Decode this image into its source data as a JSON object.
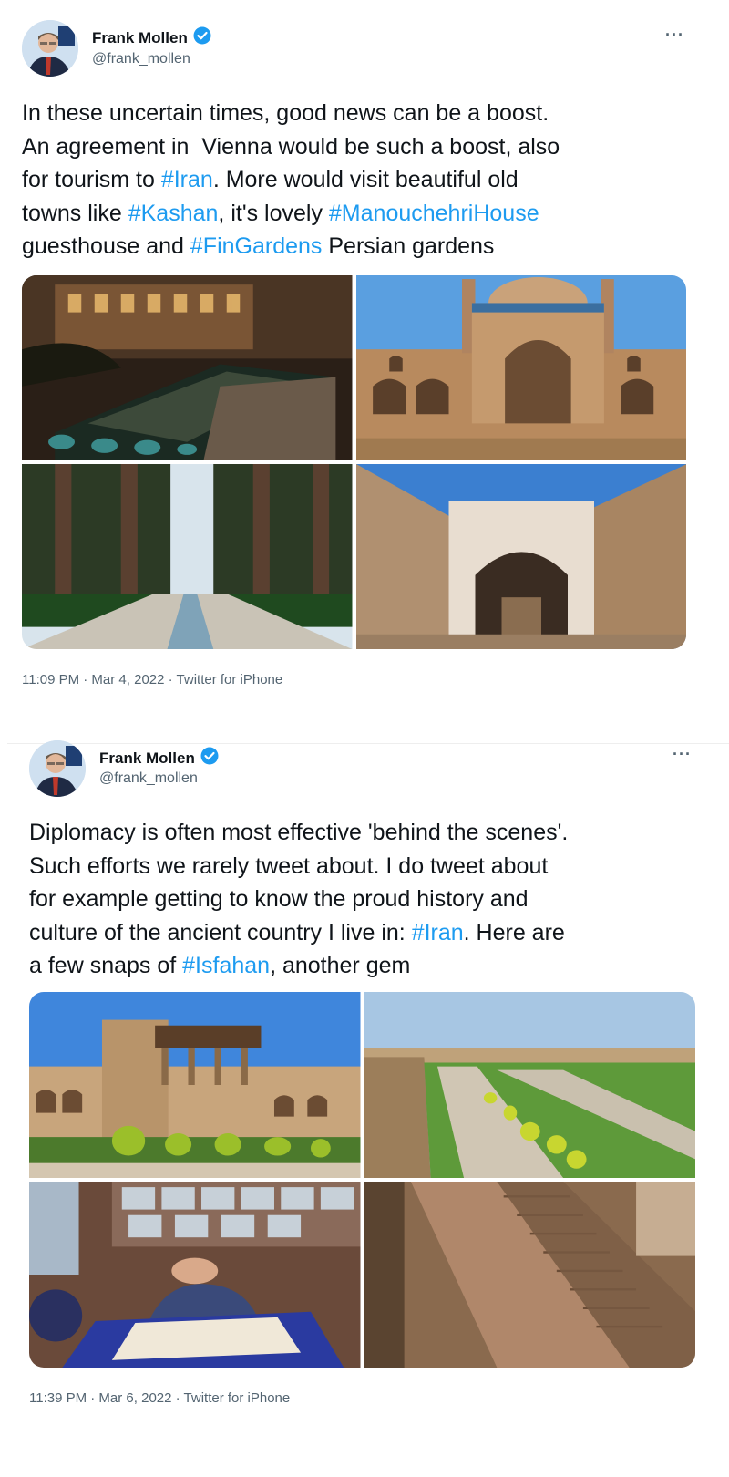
{
  "tweets": [
    {
      "author": {
        "name": "Frank Mollen",
        "handle": "@frank_mollen",
        "verified": true
      },
      "more_label": "···",
      "text_parts": [
        {
          "t": "In these uncertain times, good news can be a boost.\nAn agreement in  Vienna would be such a boost, also\nfor tourism to ",
          "tag": false
        },
        {
          "t": "#Iran",
          "tag": true
        },
        {
          "t": ". More would visit beautiful old\ntowns like ",
          "tag": false
        },
        {
          "t": "#Kashan",
          "tag": true
        },
        {
          "t": ", it's lovely ",
          "tag": false
        },
        {
          "t": "#ManouchehriHouse",
          "tag": true
        },
        {
          "t": "\nguesthouse and ",
          "tag": false
        },
        {
          "t": "#FinGardens",
          "tag": true
        },
        {
          "t": " Persian gardens",
          "tag": false
        }
      ],
      "photos": [
        "courtyard-pool-night-photo",
        "agha-bozorg-mosque-photo",
        "fin-garden-path-photo",
        "arched-alley-photo"
      ],
      "timestamp": "11:09 PM · Mar 4, 2022 · Twitter for iPhone"
    },
    {
      "author": {
        "name": "Frank Mollen",
        "handle": "@frank_mollen",
        "verified": true
      },
      "more_label": "···",
      "text_parts": [
        {
          "t": "Diplomacy is often most effective 'behind the scenes'.\nSuch efforts we rarely tweet about. I do tweet about\nfor example getting to know the proud history and\nculture of the ancient country I live in: ",
          "tag": false
        },
        {
          "t": "#Iran",
          "tag": true
        },
        {
          "t": ". Here are\na few snaps of ",
          "tag": false
        },
        {
          "t": "#Isfahan",
          "tag": true
        },
        {
          "t": ", another gem",
          "tag": false
        }
      ],
      "photos": [
        "ali-qapu-palace-photo",
        "naqsh-e-jahan-square-photo",
        "craftsman-workshop-photo",
        "carved-stone-staircase-photo"
      ],
      "timestamp": "11:39 PM · Mar 6, 2022 · Twitter for iPhone"
    }
  ],
  "colors": {
    "hashtag": "#1d9bf0",
    "verified": "#1d9bf0",
    "meta": "#536471",
    "text": "#0f1419"
  }
}
